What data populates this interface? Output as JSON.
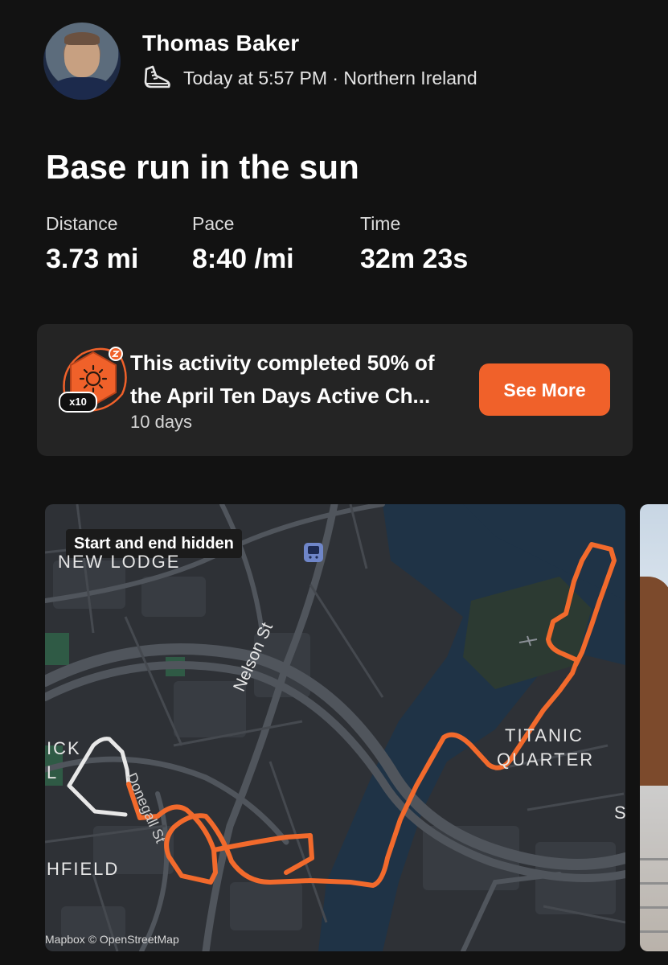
{
  "header": {
    "user_name": "Thomas Baker",
    "meta": "Today at 5:57 PM · Northern Ireland",
    "activity_icon": "running-shoe-icon"
  },
  "activity": {
    "title": "Base run in the sun",
    "stats": [
      {
        "label": "Distance",
        "value": "3.73 mi"
      },
      {
        "label": "Pace",
        "value": "8:40 /mi"
      },
      {
        "label": "Time",
        "value": "32m 23s"
      }
    ]
  },
  "challenge_card": {
    "line1": "This activity completed 50% of",
    "line2": "the April Ten Days Active Ch...",
    "subtitle": "10 days",
    "badge_count": "x10",
    "button_label": "See More",
    "accent_color": "#f0612a"
  },
  "map": {
    "privacy_label": "Start and end hidden",
    "labels": {
      "new_lodge": "NEW LODGE",
      "nelson_st": "Nelson St",
      "titanic": "TITANIC",
      "quarter": "QUARTER",
      "hfield": "HFIELD",
      "ick": "ICK",
      "donegall": "Donegall St",
      "s": "S",
      "l": "L"
    },
    "attribution": "Mapbox © OpenStreetMap",
    "route_color": "#f26a2c",
    "hidden_route_color": "#e8e8e8"
  }
}
